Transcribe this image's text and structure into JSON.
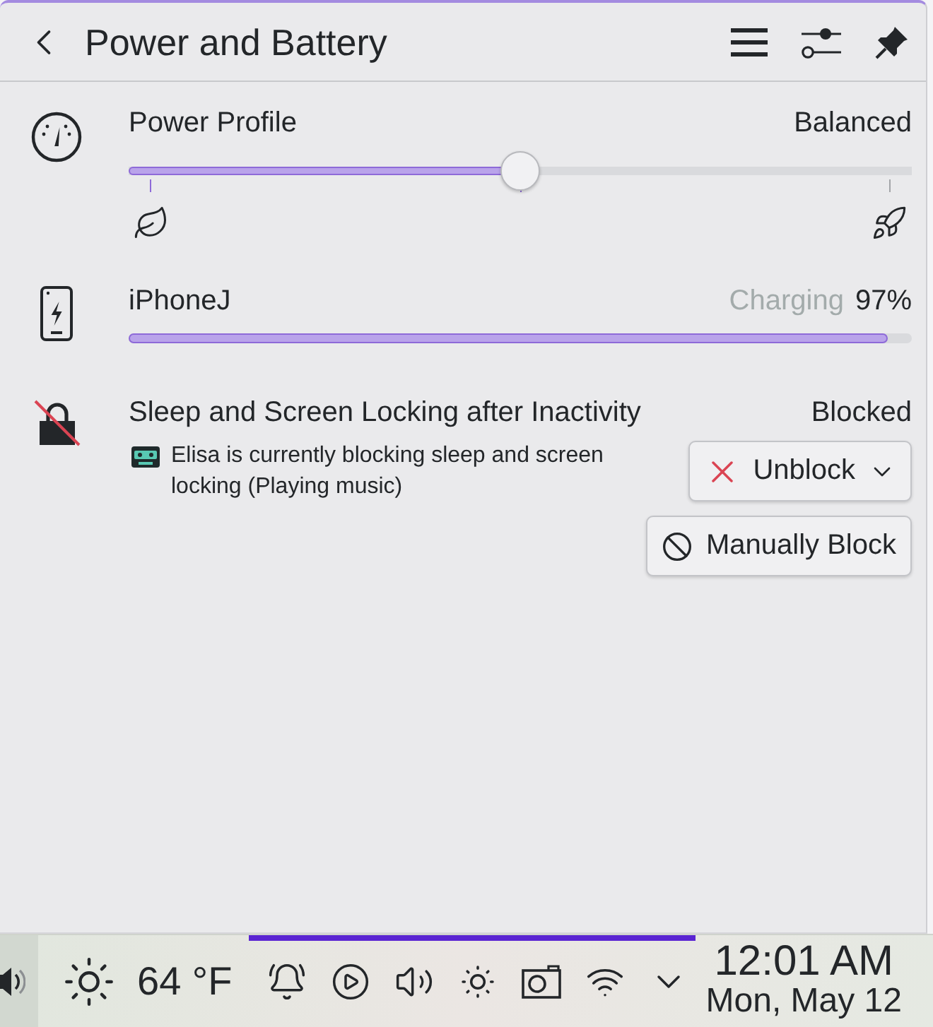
{
  "header": {
    "title": "Power and Battery"
  },
  "power_profile": {
    "label": "Power Profile",
    "value": "Balanced",
    "level": 0.5
  },
  "battery": {
    "device": "iPhoneJ",
    "status": "Charging",
    "percent": "97%",
    "level": 0.97
  },
  "inhibition": {
    "title": "Sleep and Screen Locking after Inactivity",
    "state": "Blocked",
    "apps": [
      {
        "text": "Elisa is currently blocking sleep and screen locking (Playing music)"
      }
    ],
    "buttons": [
      {
        "kind": "menu",
        "label": "Unblock"
      },
      {
        "kind": "action",
        "label": "Manually Block"
      }
    ]
  },
  "taskbar": {
    "weather": "64 °F",
    "tray": {
      "expanded": true
    },
    "clock": {
      "time": "12:01 AM",
      "date": "Mon, May 12"
    }
  }
}
